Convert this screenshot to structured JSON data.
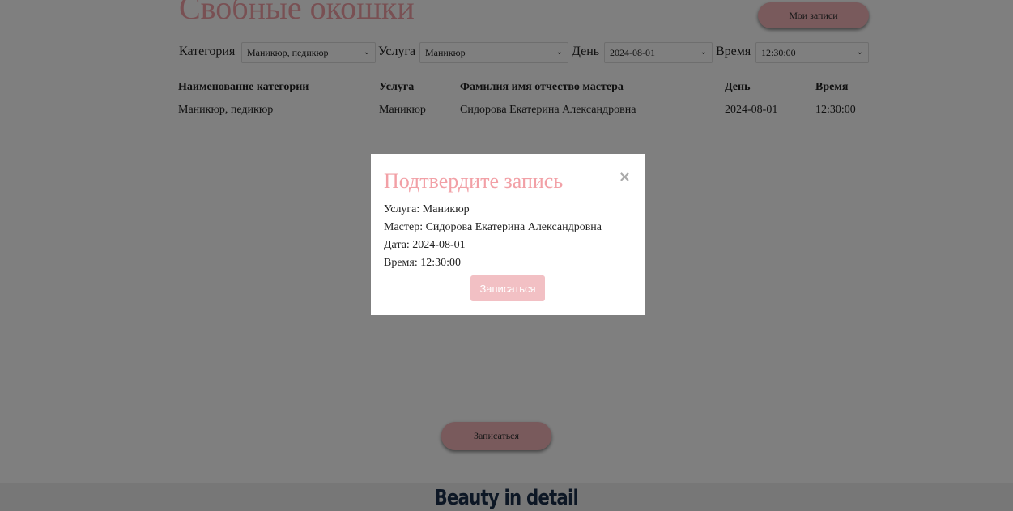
{
  "header": {
    "title": "Свобные окошки",
    "my_records_label": "Мои записи"
  },
  "filters": {
    "category_label": "Категория",
    "category_value": "Маникюр, педикюр",
    "service_label": "Услуга",
    "service_value": "Маникюр",
    "day_label": "День",
    "day_value": "2024-08-01",
    "time_label": "Время",
    "time_value": "12:30:00"
  },
  "table": {
    "headers": [
      "Наименование категории",
      "Услуга",
      "Фамилия имя отчество мастера",
      "День",
      "Время"
    ],
    "rows": [
      [
        "Маникюр, педикюр",
        "Маникюр",
        "Сидорова Екатерина Александровна",
        "2024-08-01",
        "12:30:00"
      ]
    ]
  },
  "book_button_label": "Записаться",
  "footer": {
    "brand": "Beauty in detail"
  },
  "modal": {
    "title": "Подтвердите запись",
    "close_glyph": "×",
    "service_line": "Услуга: Маникюр",
    "master_line": "Мастер: Сидорова Екатерина Александровна",
    "date_line": "Дата: 2024-08-01",
    "time_line": "Время: 12:30:00",
    "confirm_label": "Записаться"
  },
  "icons": {
    "select_chevron": "chevron-down-icon",
    "close": "close-icon"
  },
  "colors": {
    "accent": "#f2a0a6",
    "button": "#f2b4b8",
    "confirm_button": "#f2c0c4",
    "footer_text": "#1a2e4a"
  }
}
